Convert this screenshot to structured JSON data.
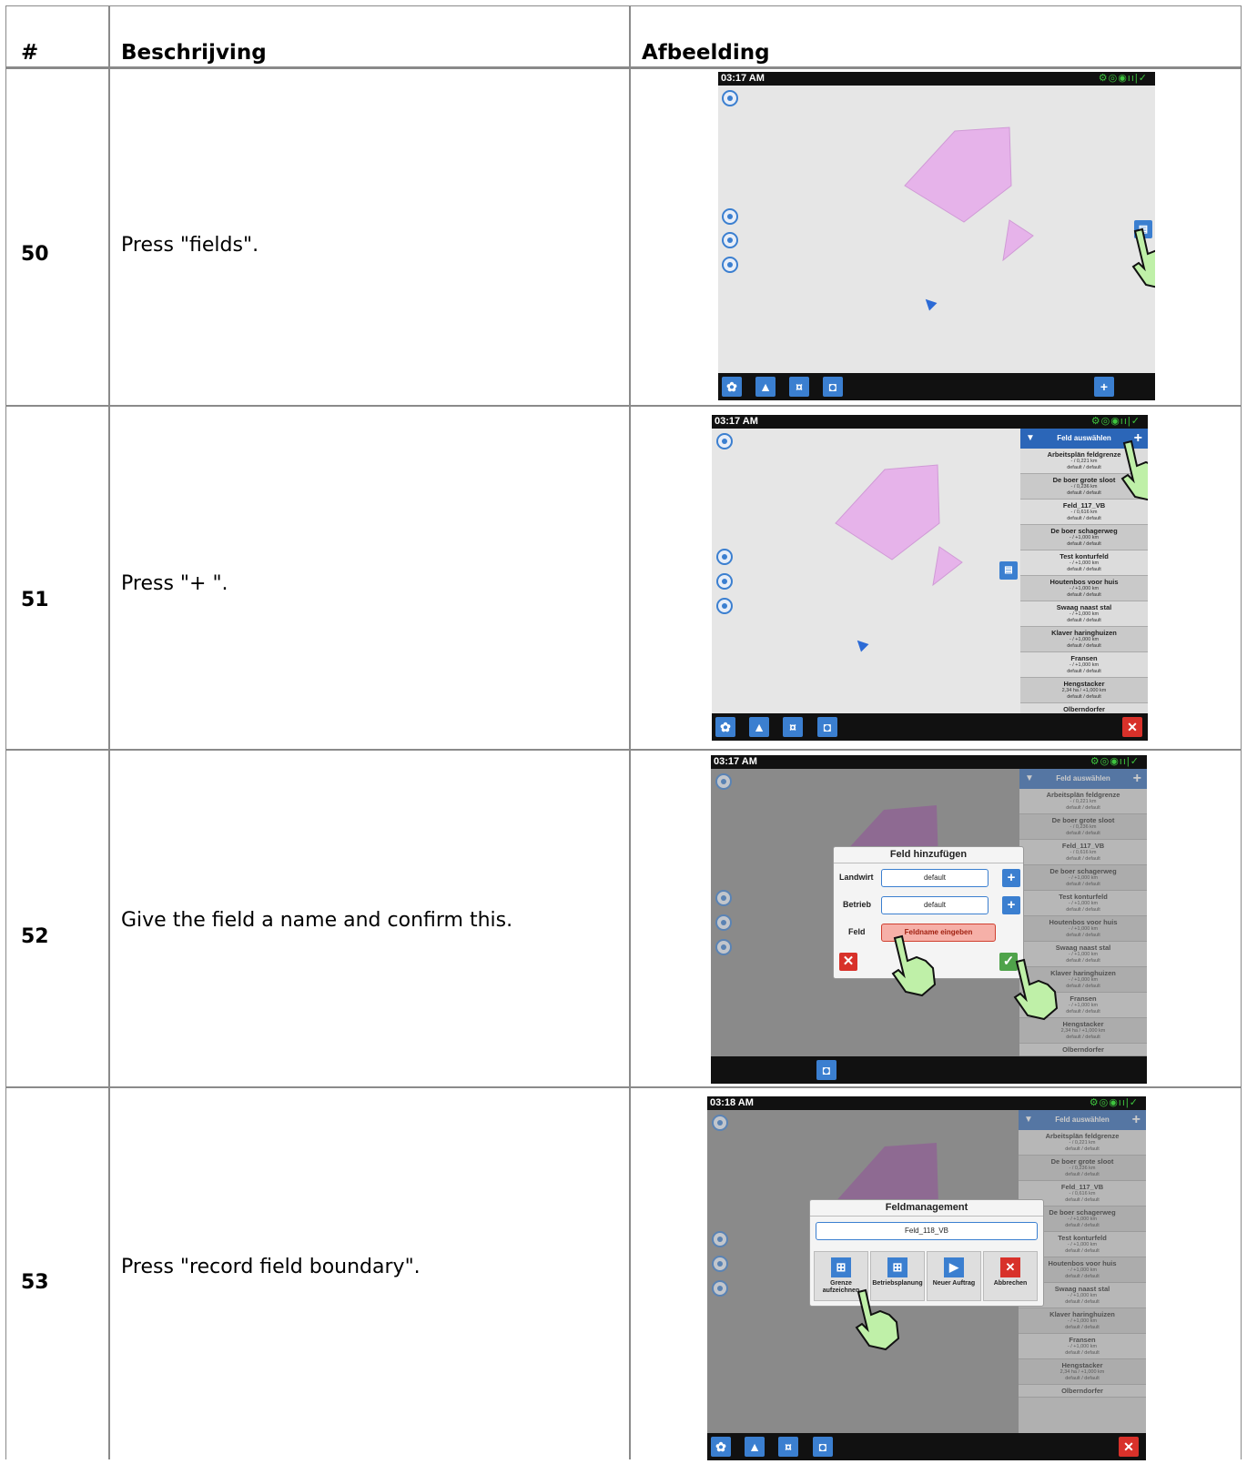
{
  "table": {
    "headers": {
      "num": "#",
      "description": "Beschrijving",
      "image": "Afbeelding"
    },
    "rows": [
      {
        "num": "50",
        "description": "Press \"fields\"."
      },
      {
        "num": "51",
        "description": "Press \"+ \"."
      },
      {
        "num": "52",
        "description": "Give the field a name and confirm this."
      },
      {
        "num": "53",
        "description": "Press \"record field boundary\"."
      }
    ]
  },
  "screens": {
    "s50": {
      "time": "03:17 AM"
    },
    "s51": {
      "time": "03:17 AM"
    },
    "s52": {
      "time": "03:17 AM"
    },
    "s53": {
      "time": "03:18 AM"
    }
  },
  "field_list": {
    "title": "Feld auswählen",
    "items": [
      {
        "name": "Arbeitsplän feldgrenze",
        "dist": "- / 0,221 km",
        "owner": "default / default"
      },
      {
        "name": "De boer grote sloot",
        "dist": "- / 0,236 km",
        "owner": "default / default"
      },
      {
        "name": "Feld_117_VB",
        "dist": "- / 0,616 km",
        "owner": "default / default"
      },
      {
        "name": "De boer schagerweg",
        "dist": "- / +1,000 km",
        "owner": "default / default"
      },
      {
        "name": "Test konturfeld",
        "dist": "- / +1,000 km",
        "owner": "default / default"
      },
      {
        "name": "Houtenbos voor huis",
        "dist": "- / +1,000 km",
        "owner": "default / default"
      },
      {
        "name": "Swaag naast stal",
        "dist": "- / +1,000 km",
        "owner": "default / default"
      },
      {
        "name": "Klaver haringhuizen",
        "dist": "- / +1,000 km",
        "owner": "default / default"
      },
      {
        "name": "Fransen",
        "dist": "- / +1,000 km",
        "owner": "default / default"
      },
      {
        "name": "Hengstacker",
        "dist": "2,34 ha / +1,000 km",
        "owner": "default / default"
      },
      {
        "name": "Olberndorfer",
        "dist": "",
        "owner": ""
      }
    ]
  },
  "add_dialog": {
    "title": "Feld hinzufügen",
    "landwirt_label": "Landwirt",
    "landwirt_value": "default",
    "betrieb_label": "Betrieb",
    "betrieb_value": "default",
    "feld_label": "Feld",
    "feld_placeholder": "Feldname eingeben"
  },
  "mgmt_dialog": {
    "title": "Feldmanagement",
    "field_name": "Feld_118_VB",
    "btn_record": "Grenze aufzeichnen",
    "btn_plan": "Betriebsplanung",
    "btn_new": "Neuer Auftrag",
    "btn_cancel": "Abbrechen"
  },
  "colors": {
    "accent": "#3b7fd0",
    "field": "#e6b3ea",
    "danger": "#d8312a"
  }
}
